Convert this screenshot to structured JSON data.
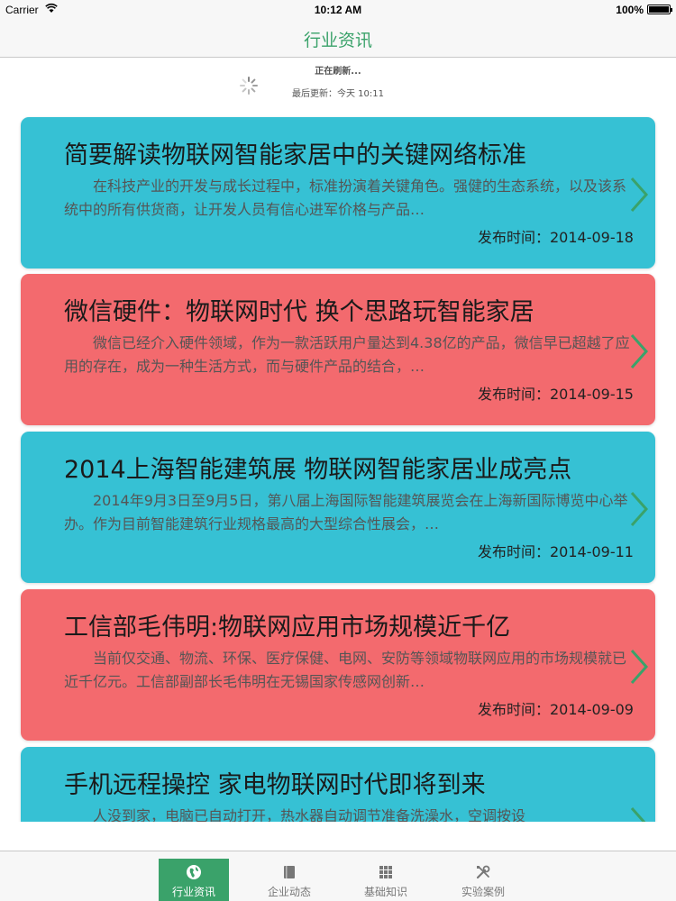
{
  "status_bar": {
    "carrier": "Carrier",
    "time": "10:12 AM",
    "battery": "100%"
  },
  "nav": {
    "title": "行业资讯"
  },
  "refresh": {
    "status": "正在刷新...",
    "last_updated": "最后更新：今天 10:11"
  },
  "news": [
    {
      "title": "简要解读物联网智能家居中的关键网络标准",
      "summary": "在科技产业的开发与成长过程中，标准扮演着关键角色。强健的生态系统，以及该系统中的所有供货商，让开发人员有信心进军价格与产品…",
      "date": "发布时间：2014-09-18",
      "color": "#36c1d4"
    },
    {
      "title": "微信硬件：物联网时代 换个思路玩智能家居",
      "summary": "微信已经介入硬件领域，作为一款活跃用户量达到4.38亿的产品，微信早已超越了应用的存在，成为一种生活方式，而与硬件产品的结合，…",
      "date": "发布时间：2014-09-15",
      "color": "#f36a6e"
    },
    {
      "title": "2014上海智能建筑展 物联网智能家居业成亮点",
      "summary": "2014年9月3日至9月5日，第八届上海国际智能建筑展览会在上海新国际博览中心举办。作为目前智能建筑行业规格最高的大型综合性展会，…",
      "date": "发布时间：2014-09-11",
      "color": "#36c1d4"
    },
    {
      "title": "工信部毛伟明:物联网应用市场规模近千亿",
      "summary": "当前仅交通、物流、环保、医疗保健、电网、安防等领域物联网应用的市场规模就已近千亿元。工信部副部长毛伟明在无锡国家传感网创新…",
      "date": "发布时间：2014-09-09",
      "color": "#f36a6e"
    },
    {
      "title": "手机远程操控 家电物联网时代即将到来",
      "summary": "人没到家，电脑已自动打开，热水器自动调节准备洗澡水，空调按设",
      "date": "",
      "color": "#36c1d4"
    }
  ],
  "tabs": [
    {
      "label": "行业资讯",
      "icon": "globe-icon",
      "active": true
    },
    {
      "label": "企业动态",
      "icon": "book-icon",
      "active": false
    },
    {
      "label": "基础知识",
      "icon": "grid-icon",
      "active": false
    },
    {
      "label": "实验案例",
      "icon": "tools-icon",
      "active": false
    }
  ],
  "colors": {
    "accent": "#3aa26a",
    "card_blue": "#36c1d4",
    "card_red": "#f36a6e"
  }
}
